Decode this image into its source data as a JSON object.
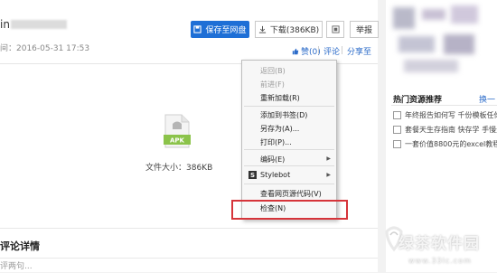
{
  "file": {
    "name_prefix": "in",
    "meta": "间：2016-05-31 17:53",
    "size_label": "文件大小：386KB",
    "icon_label": "APK"
  },
  "toolbar": {
    "save_label": "保存至网盘",
    "download_label": "下载(386KB)",
    "report_label": "举报"
  },
  "actions": {
    "like_label": "赞(0)",
    "comment_label": "评论",
    "share_label": "分享至"
  },
  "context_menu": {
    "items": [
      {
        "label": "返回(B)",
        "enabled": false
      },
      {
        "label": "前进(F)",
        "enabled": false
      },
      {
        "label": "重新加载(R)",
        "enabled": true
      },
      {
        "label": "添加到书签(D)",
        "enabled": true
      },
      {
        "label": "另存为(A)...",
        "enabled": true
      },
      {
        "label": "打印(P)...",
        "enabled": true
      },
      {
        "label": "编码(E)",
        "enabled": true,
        "submenu": true
      },
      {
        "label": "Stylebot",
        "enabled": true,
        "submenu": true,
        "icon": "stylebot-s-icon"
      },
      {
        "label": "查看网页源代码(V)",
        "enabled": true
      },
      {
        "label": "检查(N)",
        "enabled": true,
        "highlighted": true
      }
    ],
    "highlight_color": "#d6343a"
  },
  "sidebar": {
    "hot_title": "热门资源推荐",
    "swap_label": "换一",
    "items": [
      "年终报告如何写 千份模板任你选",
      "套餐天生存指南 快存学 手慢无",
      "一套价值8800元的excel教程"
    ]
  },
  "comments": {
    "title": "评论详情",
    "placeholder": "评两句..."
  },
  "watermark": {
    "text": "绿茶软件园",
    "url": "www.33lc.com"
  },
  "colors": {
    "brand_blue": "#1e6fd6",
    "link_blue": "#2b6bc9",
    "apk_green": "#8bc34a"
  }
}
